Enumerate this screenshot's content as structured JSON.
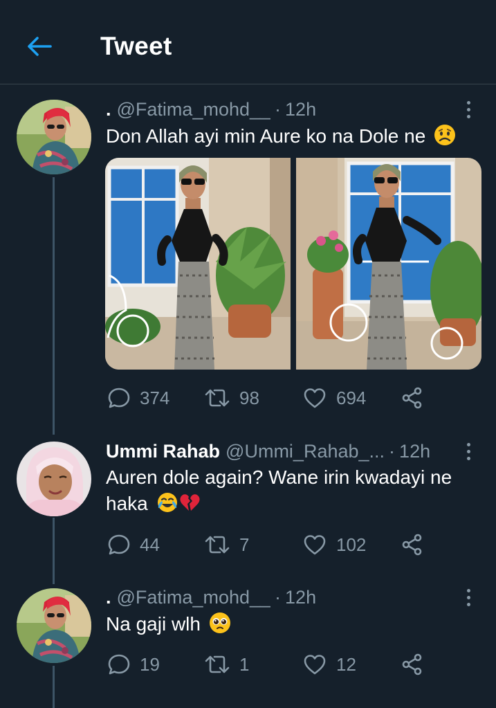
{
  "header": {
    "title": "Tweet",
    "back_icon": "arrow-left-icon",
    "accent": "#1da1f2"
  },
  "colors": {
    "background": "#15202b",
    "muted": "#8899a6",
    "divider": "#38444d",
    "thread": "#3d5466"
  },
  "tweets": [
    {
      "display_name": ".",
      "handle": "@Fatima_mohd__",
      "separator": "·",
      "time": "12h",
      "text": "Don Allah ayi min Aure ko na Dole ne",
      "emoji": "worried-face",
      "media_count": 2,
      "stats": {
        "replies": "374",
        "retweets": "98",
        "likes": "694"
      }
    },
    {
      "display_name": "Ummi Rahab",
      "handle": "@Ummi_Rahab_...",
      "separator": "·",
      "time": "12h",
      "text_line1": "Auren dole again? Wane irin kwadayi ne",
      "text_line2": "haka",
      "emojis": [
        "face-with-tears-of-joy",
        "broken-heart"
      ],
      "stats": {
        "replies": "44",
        "retweets": "7",
        "likes": "102"
      }
    },
    {
      "display_name": ".",
      "handle": "@Fatima_mohd__",
      "separator": "·",
      "time": "12h",
      "text": "Na gaji wlh",
      "emoji": "pleading-face",
      "stats": {
        "replies": "19",
        "retweets": "1",
        "likes": "12"
      }
    }
  ]
}
